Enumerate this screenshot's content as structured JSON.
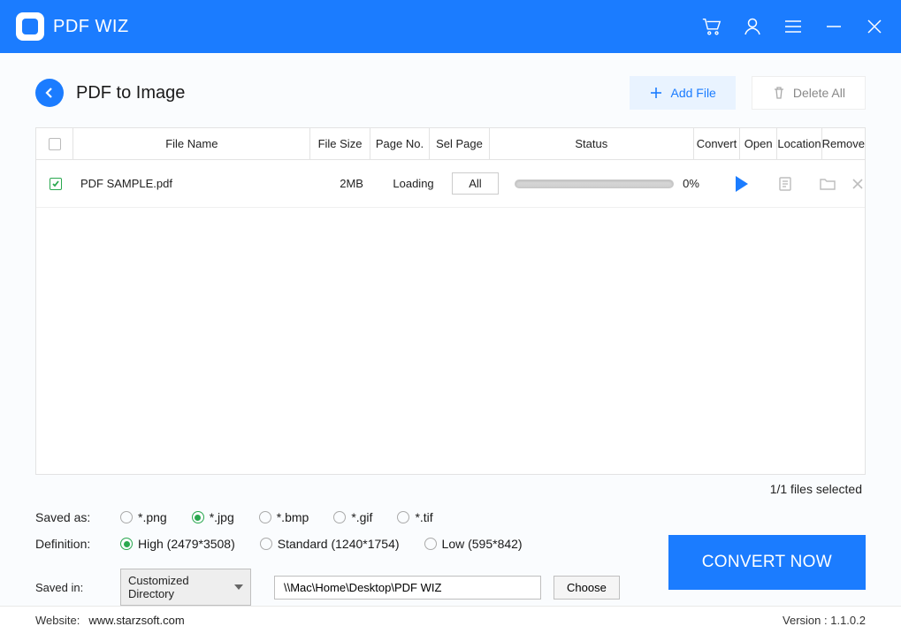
{
  "app": {
    "title": "PDF WIZ"
  },
  "page": {
    "title": "PDF to Image",
    "add_file": "Add File",
    "delete_all": "Delete All"
  },
  "table": {
    "headers": {
      "filename": "File Name",
      "filesize": "File Size",
      "pageno": "Page No.",
      "selpage": "Sel Page",
      "status": "Status",
      "convert": "Convert",
      "open": "Open",
      "location": "Location",
      "remove": "Remove"
    },
    "rows": [
      {
        "checked": true,
        "name": "PDF SAMPLE.pdf",
        "size": "2MB",
        "pageno": "Loading",
        "selpage": "All",
        "pct": "0%"
      }
    ],
    "files_selected": "1/1 files selected"
  },
  "saved_as": {
    "label": "Saved as:",
    "options": [
      "*.png",
      "*.jpg",
      "*.bmp",
      "*.gif",
      "*.tif"
    ],
    "selected": "*.jpg"
  },
  "definition": {
    "label": "Definition:",
    "options": [
      "High (2479*3508)",
      "Standard (1240*1754)",
      "Low (595*842)"
    ],
    "selected": "High (2479*3508)"
  },
  "saved_in": {
    "label": "Saved in:",
    "dropdown": "Customized Directory",
    "path": "\\\\Mac\\Home\\Desktop\\PDF WIZ",
    "choose": "Choose"
  },
  "convert_now": "CONVERT NOW",
  "footer": {
    "website_label": "Website:",
    "website": "www.starzsoft.com",
    "version_label": "Version : ",
    "version": "1.1.0.2"
  }
}
